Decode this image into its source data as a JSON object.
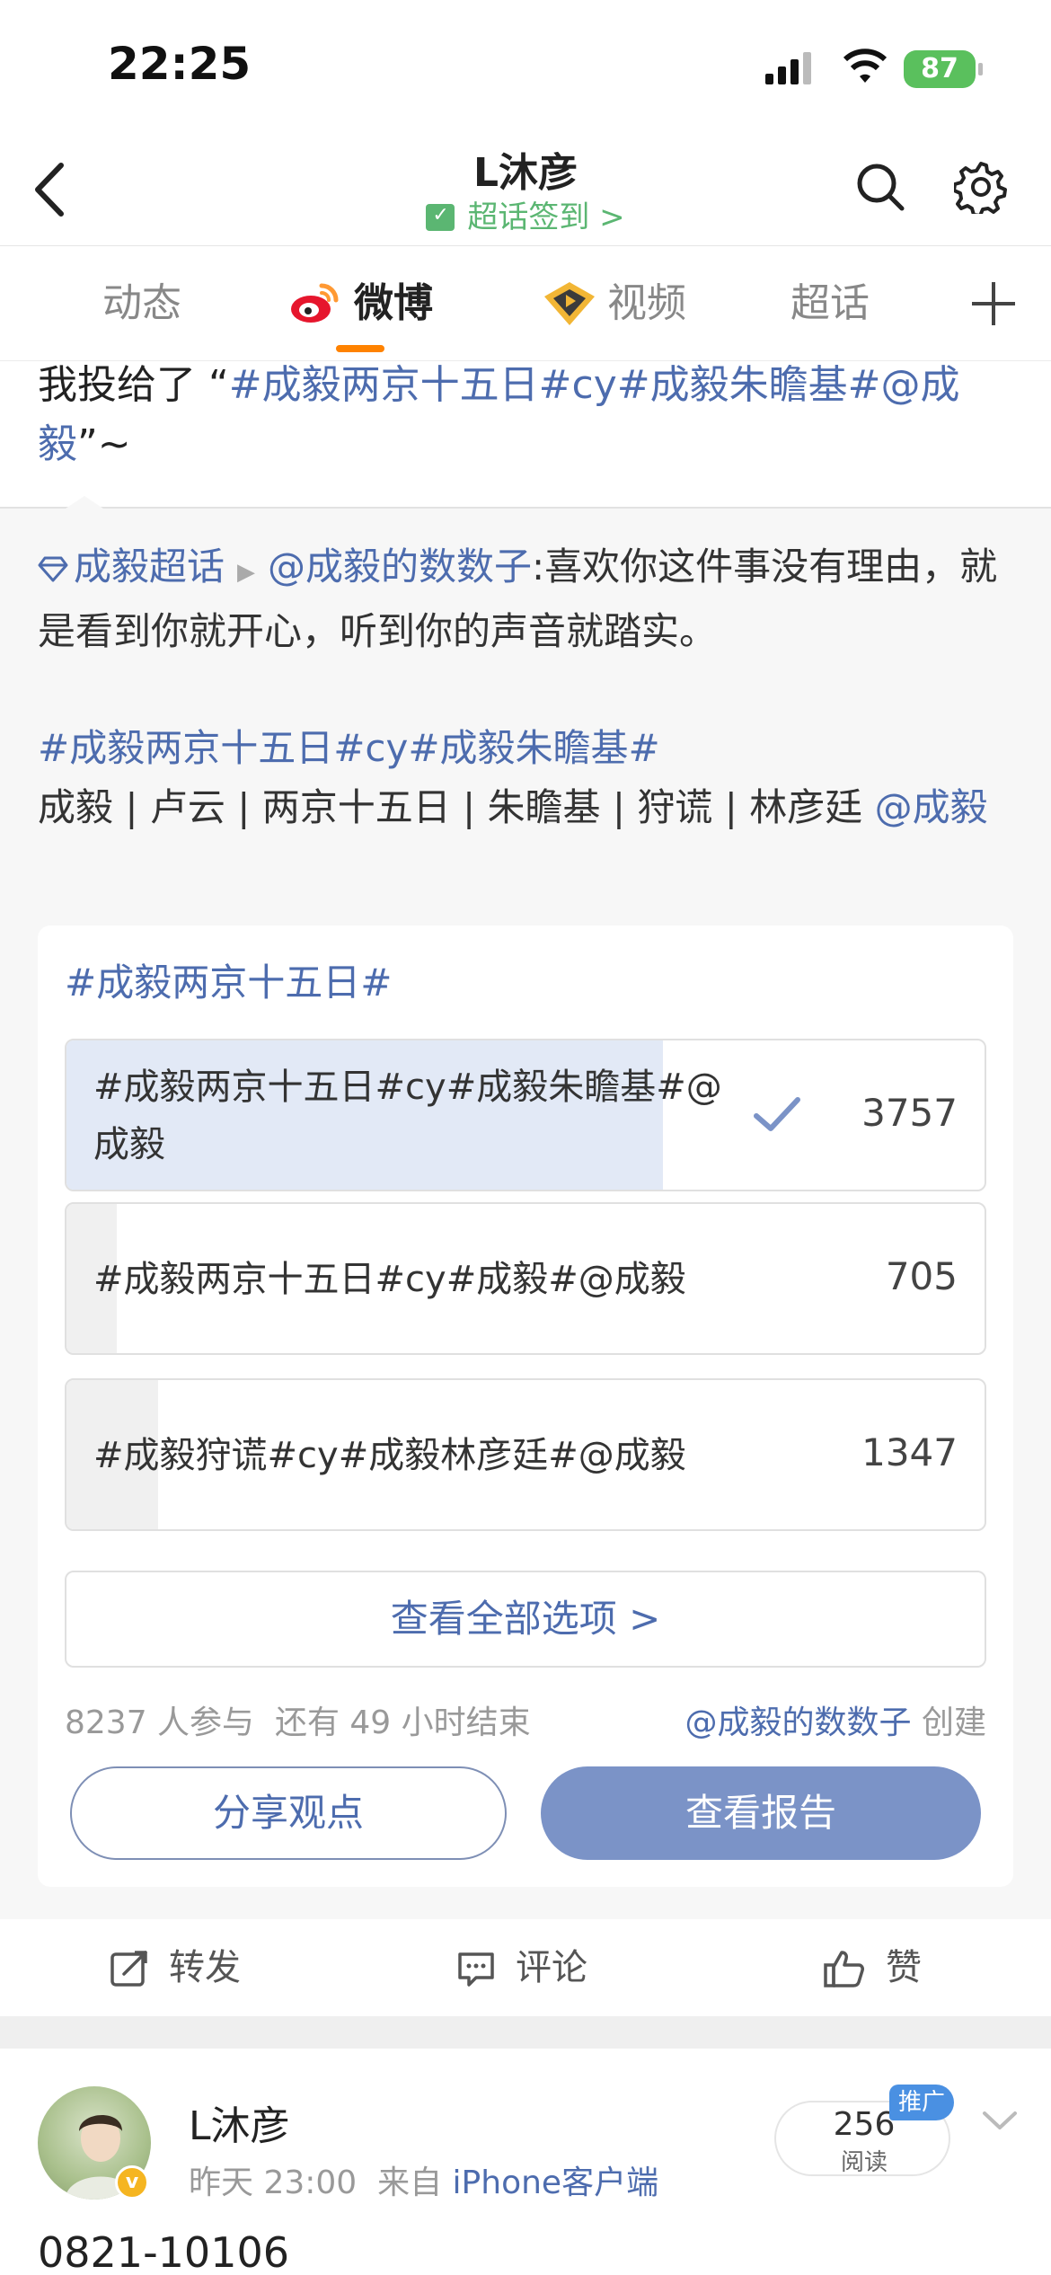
{
  "status_bar": {
    "time": "22:25",
    "battery": "87"
  },
  "header": {
    "title": "L沐彦",
    "checkin_label": "超话签到 >"
  },
  "tabs": [
    "动态",
    "微博",
    "视频",
    "超话"
  ],
  "post": {
    "prefix": "我投给了 “",
    "link_text": "#成毅两京十五日#cy#成毅朱瞻基#@成毅",
    "suffix": "”~"
  },
  "repost": {
    "source": "成毅超话",
    "author": "@成毅的数数子",
    "text": ":喜欢你这件事没有理由，就是看到你就开心，听到你的声音就踏实。",
    "hashtags": "#成毅两京十五日#cy#成毅朱瞻基#",
    "roles_text": "成毅 | 卢云 | 两京十五日 | 朱瞻基  | 狩谎 | 林彦廷 ",
    "mention": "@成毅"
  },
  "poll": {
    "title": "#成毅两京十五日#",
    "options": [
      {
        "label": "#成毅两京十五日#cy#成毅朱瞻基#@成毅",
        "count": "3757",
        "share": 0.65,
        "selected": true
      },
      {
        "label": "#成毅两京十五日#cy#成毅#@成毅",
        "count": "705",
        "share": 0.055,
        "selected": false
      },
      {
        "label": "#成毅狩谎#cy#成毅林彦廷#@成毅",
        "count": "1347",
        "share": 0.1,
        "selected": false
      }
    ],
    "view_all": "查看全部选项 >",
    "participants": "8237 人参与",
    "remaining": "还有 49 小时结束",
    "creator_name": "@成毅的数数子",
    "creator_suffix": " 创建",
    "share_button": "分享观点",
    "report_button": "查看报告"
  },
  "actions": {
    "repost": "转发",
    "comment": "评论",
    "like": "赞"
  },
  "next_post": {
    "username": "L沐彦",
    "time": "昨天 23:00",
    "source_prefix": "来自 ",
    "device": "iPhone客户端",
    "reads": "256",
    "reads_label": "阅读",
    "promo": "推广",
    "text": "0821-10106"
  },
  "colors": {
    "link": "#4d6cae",
    "accent": "#ff8200",
    "checkin": "#5bb672",
    "report_btn": "#7b93c7"
  }
}
